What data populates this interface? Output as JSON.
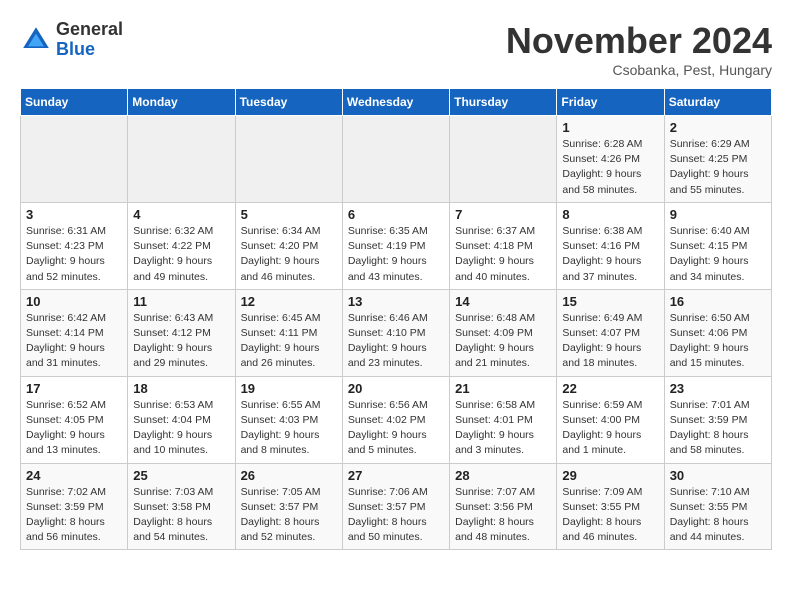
{
  "header": {
    "logo_line1": "General",
    "logo_line2": "Blue",
    "month_title": "November 2024",
    "location": "Csobanka, Pest, Hungary"
  },
  "days_of_week": [
    "Sunday",
    "Monday",
    "Tuesday",
    "Wednesday",
    "Thursday",
    "Friday",
    "Saturday"
  ],
  "weeks": [
    [
      {
        "day": "",
        "info": ""
      },
      {
        "day": "",
        "info": ""
      },
      {
        "day": "",
        "info": ""
      },
      {
        "day": "",
        "info": ""
      },
      {
        "day": "",
        "info": ""
      },
      {
        "day": "1",
        "info": "Sunrise: 6:28 AM\nSunset: 4:26 PM\nDaylight: 9 hours\nand 58 minutes."
      },
      {
        "day": "2",
        "info": "Sunrise: 6:29 AM\nSunset: 4:25 PM\nDaylight: 9 hours\nand 55 minutes."
      }
    ],
    [
      {
        "day": "3",
        "info": "Sunrise: 6:31 AM\nSunset: 4:23 PM\nDaylight: 9 hours\nand 52 minutes."
      },
      {
        "day": "4",
        "info": "Sunrise: 6:32 AM\nSunset: 4:22 PM\nDaylight: 9 hours\nand 49 minutes."
      },
      {
        "day": "5",
        "info": "Sunrise: 6:34 AM\nSunset: 4:20 PM\nDaylight: 9 hours\nand 46 minutes."
      },
      {
        "day": "6",
        "info": "Sunrise: 6:35 AM\nSunset: 4:19 PM\nDaylight: 9 hours\nand 43 minutes."
      },
      {
        "day": "7",
        "info": "Sunrise: 6:37 AM\nSunset: 4:18 PM\nDaylight: 9 hours\nand 40 minutes."
      },
      {
        "day": "8",
        "info": "Sunrise: 6:38 AM\nSunset: 4:16 PM\nDaylight: 9 hours\nand 37 minutes."
      },
      {
        "day": "9",
        "info": "Sunrise: 6:40 AM\nSunset: 4:15 PM\nDaylight: 9 hours\nand 34 minutes."
      }
    ],
    [
      {
        "day": "10",
        "info": "Sunrise: 6:42 AM\nSunset: 4:14 PM\nDaylight: 9 hours\nand 31 minutes."
      },
      {
        "day": "11",
        "info": "Sunrise: 6:43 AM\nSunset: 4:12 PM\nDaylight: 9 hours\nand 29 minutes."
      },
      {
        "day": "12",
        "info": "Sunrise: 6:45 AM\nSunset: 4:11 PM\nDaylight: 9 hours\nand 26 minutes."
      },
      {
        "day": "13",
        "info": "Sunrise: 6:46 AM\nSunset: 4:10 PM\nDaylight: 9 hours\nand 23 minutes."
      },
      {
        "day": "14",
        "info": "Sunrise: 6:48 AM\nSunset: 4:09 PM\nDaylight: 9 hours\nand 21 minutes."
      },
      {
        "day": "15",
        "info": "Sunrise: 6:49 AM\nSunset: 4:07 PM\nDaylight: 9 hours\nand 18 minutes."
      },
      {
        "day": "16",
        "info": "Sunrise: 6:50 AM\nSunset: 4:06 PM\nDaylight: 9 hours\nand 15 minutes."
      }
    ],
    [
      {
        "day": "17",
        "info": "Sunrise: 6:52 AM\nSunset: 4:05 PM\nDaylight: 9 hours\nand 13 minutes."
      },
      {
        "day": "18",
        "info": "Sunrise: 6:53 AM\nSunset: 4:04 PM\nDaylight: 9 hours\nand 10 minutes."
      },
      {
        "day": "19",
        "info": "Sunrise: 6:55 AM\nSunset: 4:03 PM\nDaylight: 9 hours\nand 8 minutes."
      },
      {
        "day": "20",
        "info": "Sunrise: 6:56 AM\nSunset: 4:02 PM\nDaylight: 9 hours\nand 5 minutes."
      },
      {
        "day": "21",
        "info": "Sunrise: 6:58 AM\nSunset: 4:01 PM\nDaylight: 9 hours\nand 3 minutes."
      },
      {
        "day": "22",
        "info": "Sunrise: 6:59 AM\nSunset: 4:00 PM\nDaylight: 9 hours\nand 1 minute."
      },
      {
        "day": "23",
        "info": "Sunrise: 7:01 AM\nSunset: 3:59 PM\nDaylight: 8 hours\nand 58 minutes."
      }
    ],
    [
      {
        "day": "24",
        "info": "Sunrise: 7:02 AM\nSunset: 3:59 PM\nDaylight: 8 hours\nand 56 minutes."
      },
      {
        "day": "25",
        "info": "Sunrise: 7:03 AM\nSunset: 3:58 PM\nDaylight: 8 hours\nand 54 minutes."
      },
      {
        "day": "26",
        "info": "Sunrise: 7:05 AM\nSunset: 3:57 PM\nDaylight: 8 hours\nand 52 minutes."
      },
      {
        "day": "27",
        "info": "Sunrise: 7:06 AM\nSunset: 3:57 PM\nDaylight: 8 hours\nand 50 minutes."
      },
      {
        "day": "28",
        "info": "Sunrise: 7:07 AM\nSunset: 3:56 PM\nDaylight: 8 hours\nand 48 minutes."
      },
      {
        "day": "29",
        "info": "Sunrise: 7:09 AM\nSunset: 3:55 PM\nDaylight: 8 hours\nand 46 minutes."
      },
      {
        "day": "30",
        "info": "Sunrise: 7:10 AM\nSunset: 3:55 PM\nDaylight: 8 hours\nand 44 minutes."
      }
    ]
  ]
}
